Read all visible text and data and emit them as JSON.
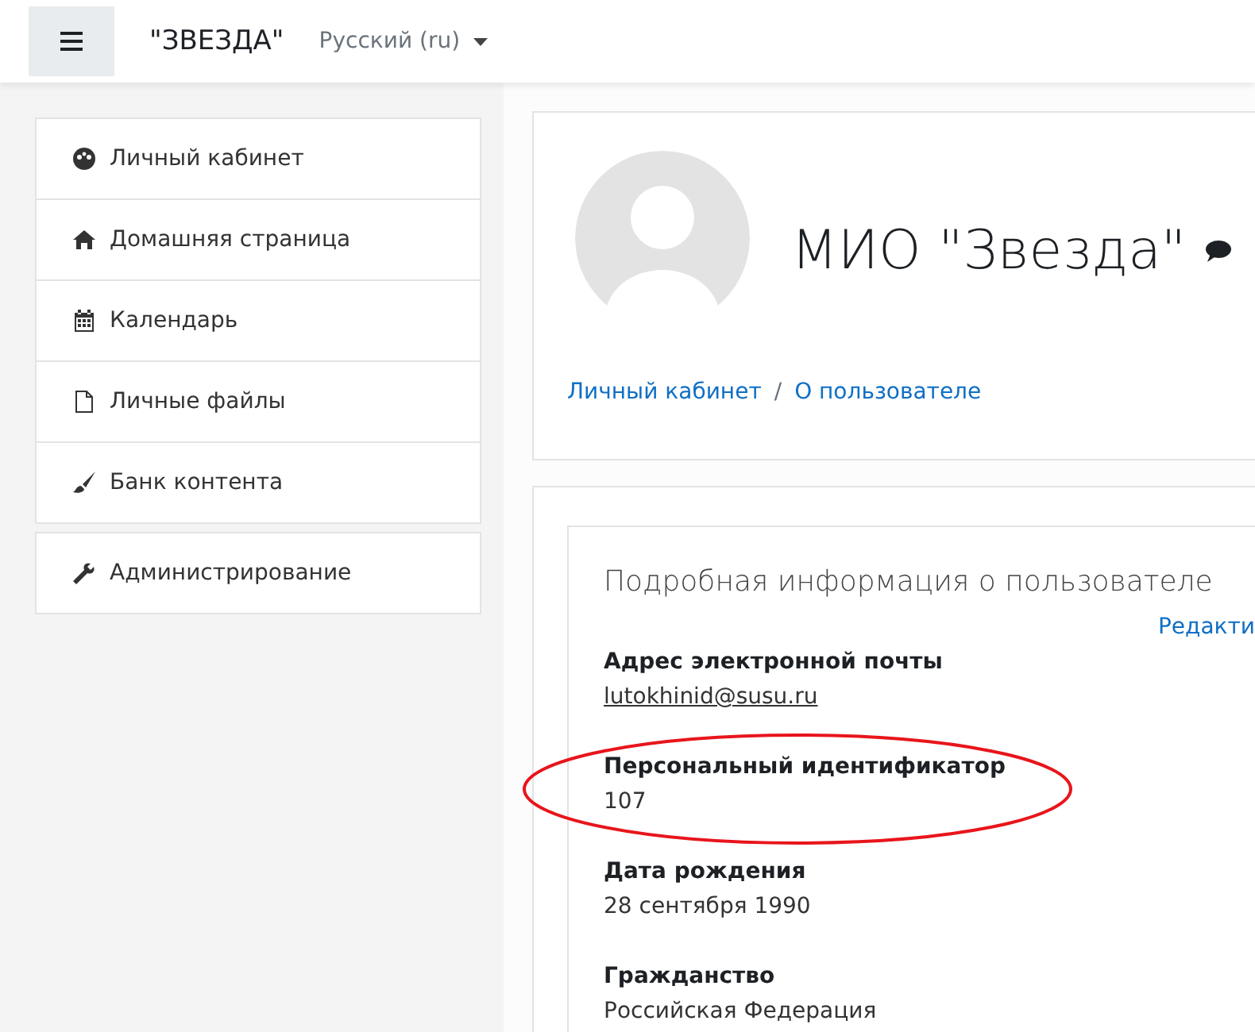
{
  "header": {
    "site_name": "\"ЗВЕЗДА\"",
    "language": "Русский (ru)"
  },
  "sidebar": {
    "groups": [
      {
        "items": [
          {
            "label": "Личный кабинет",
            "kind": "dashboard"
          },
          {
            "label": "Домашняя страница",
            "kind": "home"
          },
          {
            "label": "Календарь",
            "kind": "calendar"
          },
          {
            "label": "Личные файлы",
            "kind": "file"
          },
          {
            "label": "Банк контента",
            "kind": "brush"
          }
        ]
      },
      {
        "items": [
          {
            "label": "Администрирование",
            "kind": "wrench"
          }
        ]
      }
    ]
  },
  "profile": {
    "name": "МИО \"Звезда\"",
    "breadcrumb": [
      "Личный кабинет",
      "О пользователе"
    ],
    "breadcrumb_separator": "/"
  },
  "details": {
    "title": "Подробная информация о пользователе",
    "edit_link": "Редакти",
    "fields": [
      {
        "label": "Адрес электронной почты",
        "value": "lutokhinid@susu.ru",
        "kind": "link",
        "highlighted": false
      },
      {
        "label": "Персональный идентификатор",
        "value": "107",
        "kind": "text",
        "highlighted": true
      },
      {
        "label": "Дата рождения",
        "value": "28 сентября 1990",
        "kind": "text",
        "highlighted": false
      },
      {
        "label": "Гражданство",
        "value": "Российская Федерация",
        "kind": "text",
        "highlighted": false
      }
    ]
  }
}
